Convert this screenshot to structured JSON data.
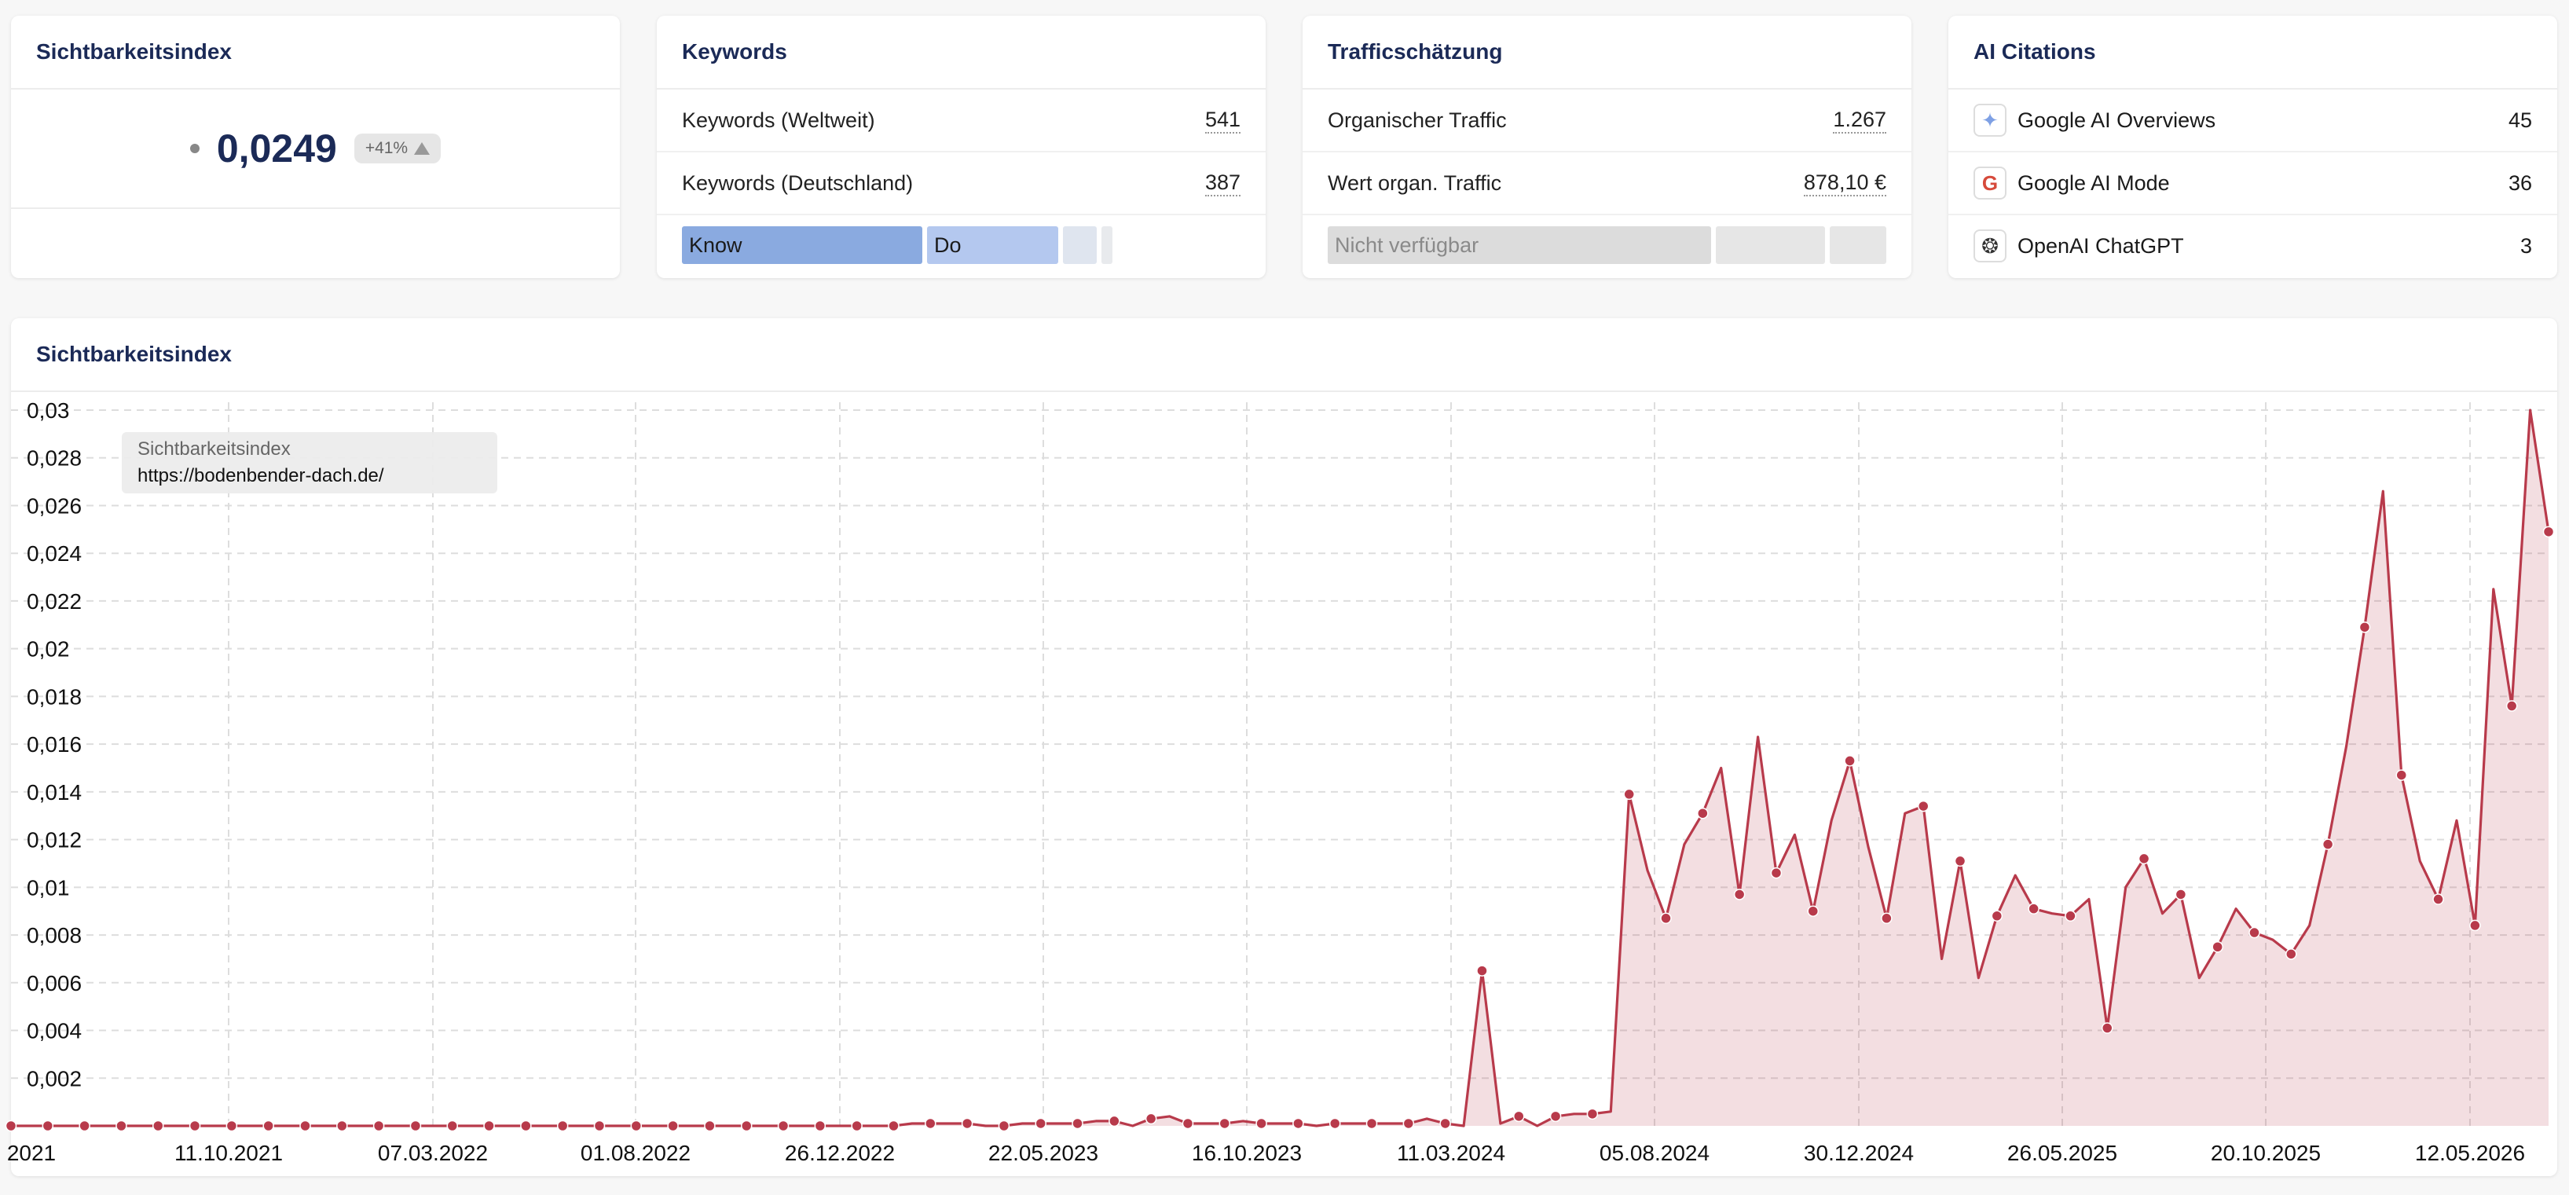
{
  "cards": {
    "visibility": {
      "title": "Sichtbarkeitsindex",
      "value": "0,0249",
      "change": "+41%"
    },
    "keywords": {
      "title": "Keywords",
      "rows": [
        {
          "label": "Keywords (Weltweit)",
          "value": "541"
        },
        {
          "label": "Keywords (Deutschland)",
          "value": "387"
        }
      ],
      "intent_bar": [
        {
          "label": "Know",
          "share": 0.43,
          "color": "#8aaae0"
        },
        {
          "label": "Do",
          "share": 0.235,
          "color": "#b4c8ef"
        },
        {
          "label": "",
          "share": 0.06,
          "color": "#dfe5ef"
        },
        {
          "label": "",
          "share": 0.02,
          "color": "#e8eaed"
        }
      ]
    },
    "traffic": {
      "title": "Trafficschätzung",
      "rows": [
        {
          "label": "Organischer Traffic",
          "value": "1.267"
        },
        {
          "label": "Wert organ. Traffic",
          "value": "878,10 €"
        }
      ],
      "bar_label": "Nicht verfügbar"
    },
    "ai": {
      "title": "AI Citations",
      "rows": [
        {
          "label": "Google AI Overviews",
          "value": "45",
          "icon": "sparkle-icon"
        },
        {
          "label": "Google AI Mode",
          "value": "36",
          "icon": "google-icon"
        },
        {
          "label": "OpenAI ChatGPT",
          "value": "3",
          "icon": "openai-icon"
        }
      ]
    }
  },
  "chart_panel": {
    "title": "Sichtbarkeitsindex",
    "tooltip": {
      "series": "Sichtbarkeitsindex",
      "url": "https://bodenbender-dach.de/"
    }
  },
  "chart_data": {
    "type": "area",
    "ylim": [
      0,
      0.03
    ],
    "yticks": [
      "0,03",
      "0,028",
      "0,026",
      "0,024",
      "0,022",
      "0,02",
      "0,018",
      "0,016",
      "0,014",
      "0,012",
      "0,01",
      "0,008",
      "0,006",
      "0,004",
      "0,002"
    ],
    "ytick_values": [
      0.03,
      0.028,
      0.026,
      0.024,
      0.022,
      0.02,
      0.018,
      0.016,
      0.014,
      0.012,
      0.01,
      0.008,
      0.006,
      0.004,
      0.002
    ],
    "xticks": [
      "2021",
      "11.10.2021",
      "07.03.2022",
      "01.08.2022",
      "26.12.2022",
      "22.05.2023",
      "16.10.2023",
      "11.03.2024",
      "05.08.2024",
      "30.12.2024",
      "26.05.2025",
      "20.10.2025",
      "12.05.2026"
    ],
    "series_color": "#b83a4b",
    "values": [
      0,
      0,
      0,
      0,
      0,
      0,
      0,
      0,
      0,
      0,
      0,
      0,
      0,
      0,
      0,
      0,
      0,
      0,
      0,
      0,
      0,
      0,
      0,
      0,
      0,
      0,
      0,
      0,
      0,
      0,
      0,
      0,
      0,
      0,
      0,
      0,
      0,
      0,
      0,
      0,
      0,
      0,
      0,
      0,
      0,
      0,
      0,
      0,
      0,
      0.0001,
      0.0001,
      0.0001,
      0.0001,
      0,
      0,
      0.0001,
      0.0001,
      0.0001,
      0.0001,
      0.0002,
      0.0002,
      0,
      0.0003,
      0.0004,
      0.0001,
      0.0001,
      0.0001,
      0.0002,
      0.0001,
      0.0001,
      0.0001,
      0,
      0.0001,
      0.0001,
      0.0001,
      0.0001,
      0.0001,
      0.0003,
      0.0001,
      0,
      0.0065,
      0.0001,
      0.0004,
      0,
      0.0004,
      0.0005,
      0.0005,
      0.0006,
      0.0139,
      0.0107,
      0.0087,
      0.0118,
      0.0131,
      0.015,
      0.0097,
      0.0163,
      0.0106,
      0.0122,
      0.009,
      0.0128,
      0.0153,
      0.0117,
      0.0087,
      0.0131,
      0.0134,
      0.007,
      0.0111,
      0.0062,
      0.0088,
      0.0105,
      0.0091,
      0.0089,
      0.0088,
      0.0095,
      0.0041,
      0.01,
      0.0112,
      0.0089,
      0.0097,
      0.0062,
      0.0075,
      0.0091,
      0.0081,
      0.0078,
      0.0072,
      0.0084,
      0.0118,
      0.0159,
      0.0209,
      0.0266,
      0.0147,
      0.0111,
      0.0095,
      0.0128,
      0.0084,
      0.0225,
      0.0176,
      0.03,
      0.0249
    ]
  }
}
